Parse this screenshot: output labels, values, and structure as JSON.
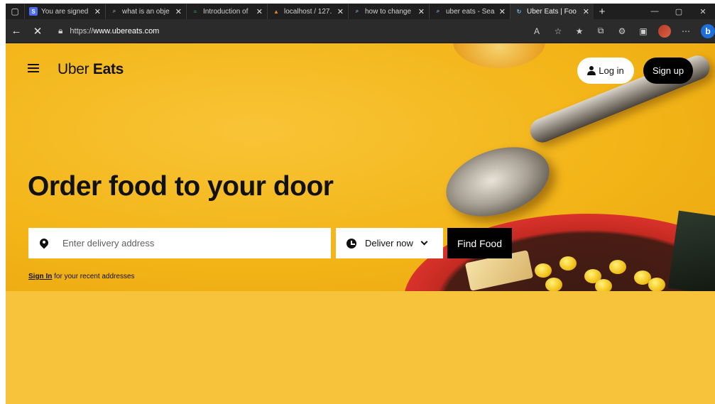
{
  "browser": {
    "tabs": [
      {
        "title": "You are signed",
        "favicon": "S",
        "color": "#4a6cf7",
        "active": false
      },
      {
        "title": "what is an obje",
        "favicon": "search-icon",
        "color": "#3a3a3a",
        "active": false
      },
      {
        "title": "Introduction of",
        "favicon": "gfg-icon",
        "color": "#2f8d46",
        "active": false
      },
      {
        "title": "localhost / 127.",
        "favicon": "phpmyadmin-icon",
        "color": "#e58b1b",
        "active": false
      },
      {
        "title": "how to change",
        "favicon": "search-icon",
        "color": "#3a3a3a",
        "active": false
      },
      {
        "title": "uber eats - Sea",
        "favicon": "search-icon",
        "color": "#3a3a3a",
        "active": false
      },
      {
        "title": "Uber Eats | Foo",
        "favicon": "loading-icon",
        "color": "#3a3a3a",
        "active": true
      }
    ],
    "url_prefix": "https://",
    "url_host": "www.ubereats.com"
  },
  "header": {
    "logo_part1": "Uber",
    "logo_part2": " Eats",
    "login_label": "Log in",
    "signup_label": "Sign up"
  },
  "hero": {
    "headline": "Order food to your door",
    "address_placeholder": "Enter delivery address",
    "deliver_label": "Deliver now",
    "find_label": "Find Food",
    "signin_link": "Sign In",
    "signin_suffix": " for your recent addresses"
  },
  "colors": {
    "brand_yellow": "#f7c33a",
    "black": "#000000",
    "white": "#ffffff"
  }
}
